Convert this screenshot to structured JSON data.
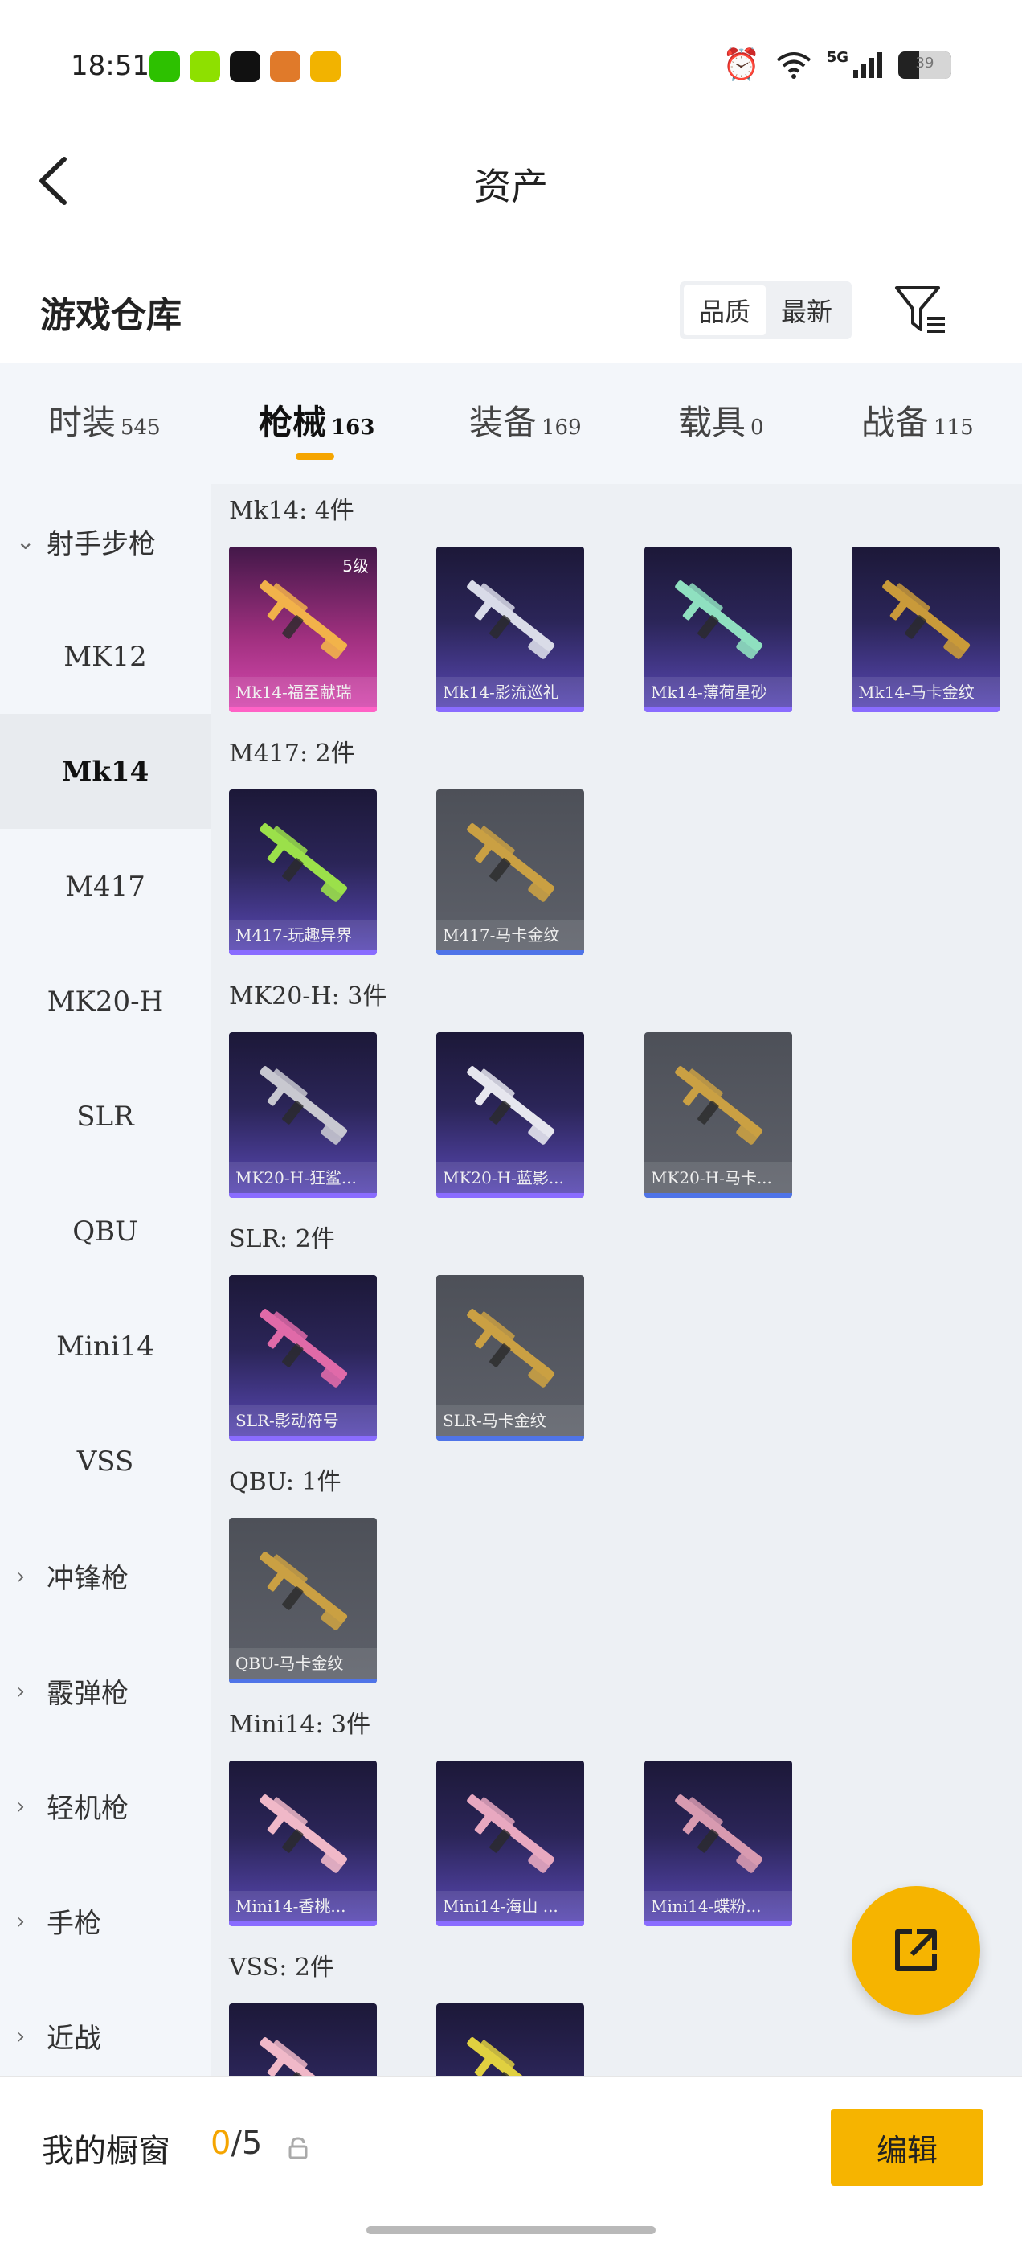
{
  "status_bar": {
    "time": "18:51",
    "network": "5G",
    "battery": "39",
    "battery_fraction": 0.39,
    "app_icons": [
      {
        "name": "wechat-icon",
        "color": "#2dc100"
      },
      {
        "name": "green-app-icon",
        "color": "#8ee000"
      },
      {
        "name": "tiktok-icon",
        "color": "#111111"
      },
      {
        "name": "game-app-icon",
        "color": "#e07a2a"
      },
      {
        "name": "weibo-icon",
        "color": "#f2b300"
      }
    ]
  },
  "header": {
    "title": "资产"
  },
  "warehouse": {
    "title": "游戏仓库",
    "sort_options": [
      {
        "label": "品质",
        "active": true
      },
      {
        "label": "最新",
        "active": false
      }
    ]
  },
  "tabs": [
    {
      "label": "时装",
      "count": "545",
      "active": false
    },
    {
      "label": "枪械",
      "count": "163",
      "active": true
    },
    {
      "label": "装备",
      "count": "169",
      "active": false
    },
    {
      "label": "载具",
      "count": "0",
      "active": false
    },
    {
      "label": "战备",
      "count": "115",
      "active": false
    }
  ],
  "categories": [
    {
      "label": "射手步枪",
      "type": "group-open"
    },
    {
      "label": "MK12",
      "type": "item"
    },
    {
      "label": "Mk14",
      "type": "item",
      "active": true
    },
    {
      "label": "M417",
      "type": "item"
    },
    {
      "label": "MK20-H",
      "type": "item"
    },
    {
      "label": "SLR",
      "type": "item"
    },
    {
      "label": "QBU",
      "type": "item"
    },
    {
      "label": "Mini14",
      "type": "item"
    },
    {
      "label": "VSS",
      "type": "item"
    },
    {
      "label": "冲锋枪",
      "type": "group"
    },
    {
      "label": "霰弹枪",
      "type": "group"
    },
    {
      "label": "轻机枪",
      "type": "group"
    },
    {
      "label": "手枪",
      "type": "group"
    },
    {
      "label": "近战",
      "type": "group"
    }
  ],
  "sections": [
    {
      "title": "Mk14: 4件",
      "items": [
        {
          "label": "Mk14-福至献瑞",
          "rarity": "pink",
          "level": "5级",
          "gun_color": "#f2b24a"
        },
        {
          "label": "Mk14-影流巡礼",
          "rarity": "purple",
          "gun_color": "#d9dbe8"
        },
        {
          "label": "Mk14-薄荷星砂",
          "rarity": "purple",
          "gun_color": "#8fe0c0"
        },
        {
          "label": "Mk14-马卡金纹",
          "rarity": "purple",
          "gun_color": "#c99a3a"
        }
      ]
    },
    {
      "title": "M417: 2件",
      "items": [
        {
          "label": "M417-玩趣异界",
          "rarity": "purple",
          "gun_color": "#9be04a"
        },
        {
          "label": "M417-马卡金纹",
          "rarity": "gray",
          "gun_color": "#caa043"
        }
      ]
    },
    {
      "title": "MK20-H: 3件",
      "items": [
        {
          "label": "MK20-H-狂鲨...",
          "rarity": "purple",
          "gun_color": "#c8c8d0"
        },
        {
          "label": "MK20-H-蓝影...",
          "rarity": "purple",
          "gun_color": "#e6e6ee"
        },
        {
          "label": "MK20-H-马卡...",
          "rarity": "gray",
          "gun_color": "#caa043"
        }
      ]
    },
    {
      "title": "SLR: 2件",
      "items": [
        {
          "label": "SLR-影动符号",
          "rarity": "purple",
          "gun_color": "#e06aa8"
        },
        {
          "label": "SLR-马卡金纹",
          "rarity": "gray",
          "gun_color": "#caa043"
        }
      ]
    },
    {
      "title": "QBU: 1件",
      "items": [
        {
          "label": "QBU-马卡金纹",
          "rarity": "gray",
          "gun_color": "#caa043"
        }
      ]
    },
    {
      "title": "Mini14: 3件",
      "items": [
        {
          "label": "Mini14-香桃...",
          "rarity": "purple",
          "gun_color": "#f0b8c8"
        },
        {
          "label": "Mini14-海山 ...",
          "rarity": "purple",
          "gun_color": "#e8a8c0"
        },
        {
          "label": "Mini14-蝶粉...",
          "rarity": "purple",
          "gun_color": "#d89ab0"
        }
      ]
    },
    {
      "title": "VSS: 2件",
      "items": [
        {
          "label": "",
          "rarity": "purple",
          "gun_color": "#f0b8c8"
        },
        {
          "label": "",
          "rarity": "purple",
          "gun_color": "#e0d040"
        }
      ]
    }
  ],
  "bottom": {
    "showcase_title": "我的橱窗",
    "current": "0",
    "total": "/5",
    "edit_label": "编辑"
  }
}
